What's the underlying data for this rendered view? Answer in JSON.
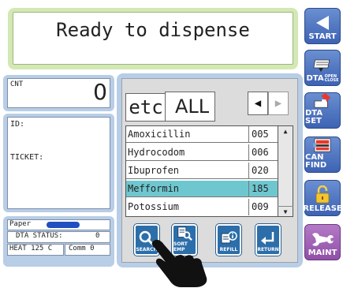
{
  "status": {
    "message": "Ready to dispense"
  },
  "counter": {
    "label": "CNT",
    "value": "0"
  },
  "info": {
    "id_label": "ID:",
    "ticket_label": "TICKET:"
  },
  "machine_status": {
    "paper_label": "Paper",
    "dta_status_label": "DTA STATUS:",
    "dta_status_value": "0",
    "heat_label": "HEAT 125  C",
    "comm_label": "Comm 0"
  },
  "filter": {
    "category": "etc",
    "group": "ALL"
  },
  "drug_list": [
    {
      "name": "Amoxicillin",
      "code": "005",
      "selected": false
    },
    {
      "name": "Hydrocodom",
      "code": "006",
      "selected": false
    },
    {
      "name": "Ibuprofen",
      "code": "020",
      "selected": false
    },
    {
      "name": "Mefformin",
      "code": "185",
      "selected": true
    },
    {
      "name": "Potossium",
      "code": "009",
      "selected": false
    }
  ],
  "toolbar": {
    "search_label": "SEARCH",
    "sort_label": "SORT EMP",
    "refill_label": "REFILL",
    "return_label": "RETURN"
  },
  "side_buttons": {
    "start_label": "START",
    "dta_open_label": "DTA",
    "dta_open_sub1": "OPEN",
    "dta_open_sub2": "CLOSE",
    "dta_set_label": "DTA SET",
    "can_find_label": "CAN FIND",
    "release_label": "RELEASE",
    "maint_label": "MAINT"
  },
  "colors": {
    "banner_green": "#d3e8b4",
    "frame_blue": "#b8cde6",
    "selected_row": "#6ec7cf",
    "side_button_blue": "#4a70bf",
    "side_button_purple": "#a063b6",
    "tool_button_blue": "#2c6ea9"
  }
}
